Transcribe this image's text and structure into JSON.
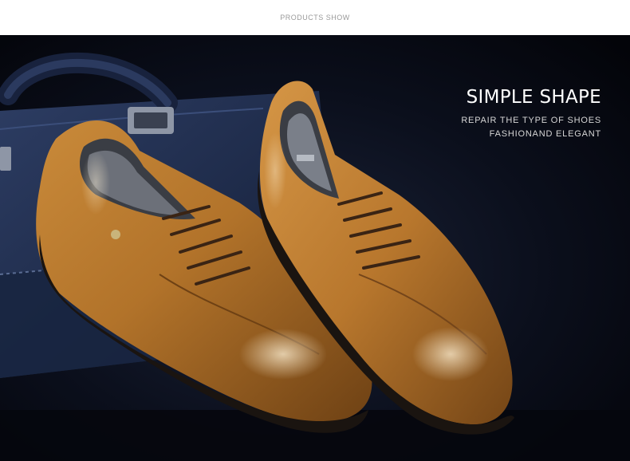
{
  "header": {
    "section_label": "PRODUCTS SHOW"
  },
  "hero": {
    "headline": "SIMPLE SHAPE",
    "subline_1": "REPAIR THE TYPE OF SHOES",
    "subline_2": "FASHIONAND ELEGANT",
    "image_subject": "pair of tan leather lace-up derby shoes on a navy leather briefcase"
  },
  "colors": {
    "background_top": "#ffffff",
    "hero_background": "#05070d",
    "leather_tan": "#b87a2c",
    "briefcase_navy": "#22304f",
    "headline_text": "#ffffff",
    "section_label_text": "#9a9a9a"
  }
}
